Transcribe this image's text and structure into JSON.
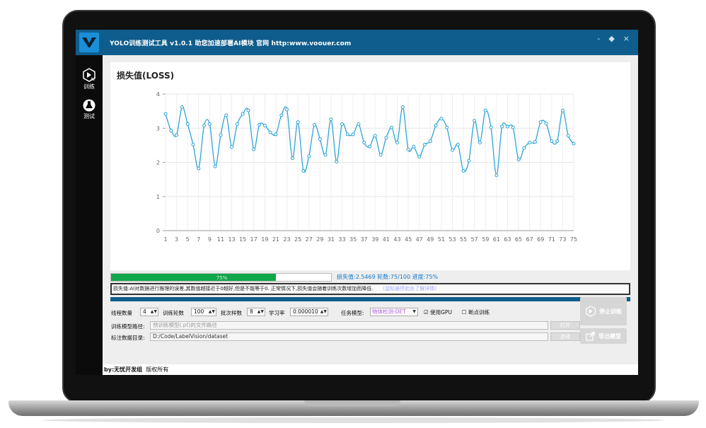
{
  "app": {
    "title": "YOLO训练测试工具 v1.0.1   助您加速部署AI模块   官网 http:www.voouer.com",
    "window_buttons": [
      "-",
      "◆",
      "×"
    ]
  },
  "sidebar": {
    "items": [
      {
        "label": "训练",
        "icon": "ai-train-icon"
      },
      {
        "label": "测试",
        "icon": "flask-icon"
      }
    ]
  },
  "chart": {
    "title": "损失值(LOSS)"
  },
  "chart_data": {
    "type": "line",
    "title": "损失值(LOSS)",
    "xlabel": "",
    "ylabel": "",
    "ylim": [
      0,
      4
    ],
    "yticks": [
      0,
      1,
      2,
      3,
      4
    ],
    "xticks": [
      1,
      3,
      5,
      7,
      9,
      11,
      13,
      15,
      17,
      19,
      21,
      23,
      25,
      27,
      29,
      31,
      33,
      35,
      37,
      39,
      41,
      43,
      45,
      47,
      49,
      51,
      53,
      55,
      57,
      59,
      61,
      63,
      65,
      67,
      69,
      71,
      73,
      75
    ],
    "x": [
      1,
      2,
      3,
      4,
      5,
      6,
      7,
      8,
      9,
      10,
      11,
      12,
      13,
      14,
      15,
      16,
      17,
      18,
      19,
      20,
      21,
      22,
      23,
      24,
      25,
      26,
      27,
      28,
      29,
      30,
      31,
      32,
      33,
      34,
      35,
      36,
      37,
      38,
      39,
      40,
      41,
      42,
      43,
      44,
      45,
      46,
      47,
      48,
      49,
      50,
      51,
      52,
      53,
      54,
      55,
      56,
      57,
      58,
      59,
      60,
      61,
      62,
      63,
      64,
      65,
      66,
      67,
      68,
      69,
      70,
      71,
      72,
      73,
      74,
      75
    ],
    "series": [
      {
        "values": [
          3.42,
          2.93,
          2.8,
          3.62,
          3.12,
          2.52,
          1.82,
          3.08,
          3.12,
          1.88,
          2.8,
          3.38,
          2.45,
          3.12,
          3.42,
          3.52,
          2.38,
          3.1,
          3.08,
          2.88,
          2.82,
          3.38,
          3.55,
          2.12,
          3.18,
          1.75,
          2.18,
          3.1,
          2.68,
          2.22,
          3.26,
          2.02,
          3.12,
          2.82,
          2.82,
          3.12,
          2.58,
          2.46,
          2.78,
          2.22,
          2.72,
          3.02,
          2.58,
          3.62,
          2.38,
          2.46,
          2.16,
          2.52,
          2.62,
          3.08,
          3.28,
          3.02,
          2.36,
          2.52,
          1.75,
          2.05,
          3.22,
          2.58,
          3.52,
          3.02,
          1.62,
          3.05,
          3.05,
          3.02,
          2.08,
          2.42,
          2.58,
          2.6,
          3.18,
          3.14,
          2.62,
          2.62,
          3.52,
          2.78,
          2.55
        ],
        "color": "#2ea4d6"
      }
    ],
    "grid": true
  },
  "progress": {
    "fraction": 0.75,
    "text": "75%",
    "status": "损失值:2.5469  轮数:75/100  进度:75%"
  },
  "info": {
    "text": "损失值:AI对数据进行推理的误差,其数值越接近于0越好,但是不能等于0. 正常情况下,损失值会随着训练次数增加而降低.",
    "hint": "(鼠标悬停此处了解详情)"
  },
  "params": {
    "threads_label": "线程数量",
    "threads_value": "4",
    "epochs_label": "训练轮数",
    "epochs_value": "100",
    "batch_label": "批次样数",
    "batch_value": "8",
    "lr_label": "学习率",
    "lr_value": "0.000010",
    "task_label": "任务模型:",
    "task_value": "物体检测-DET",
    "gpu_label": "使用GPU",
    "gpu_checked": true,
    "resume_label": "断点训练",
    "resume_checked": false
  },
  "paths": {
    "model_label": "训练模型路径:",
    "model_placeholder": "预训练模型(.pt)的文件路径",
    "open_label": "打开",
    "dataset_label": "标注数据目录:",
    "dataset_value": "D:/Code/LabelVision/dataset",
    "select_label": "选择"
  },
  "actions": {
    "stop_label": "停止训练",
    "export_label": "导出模型"
  },
  "footer": {
    "author": "by:无忧开发组",
    "rights": "版权所有"
  }
}
